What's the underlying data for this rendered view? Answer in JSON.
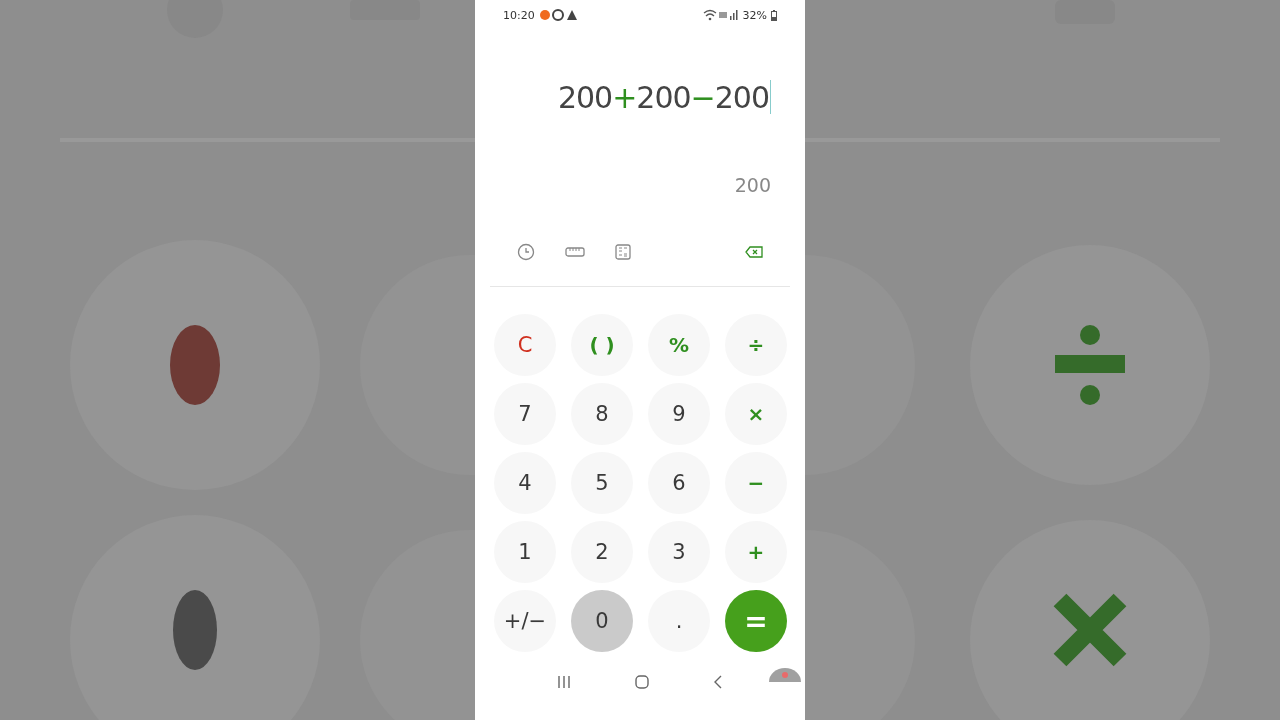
{
  "status_bar": {
    "time": "10:20",
    "battery": "32%"
  },
  "display": {
    "expression": [
      {
        "text": "200",
        "kind": "number"
      },
      {
        "text": "+",
        "kind": "operator"
      },
      {
        "text": "200",
        "kind": "number"
      },
      {
        "text": "−",
        "kind": "operator"
      },
      {
        "text": "200",
        "kind": "number"
      }
    ],
    "result": "200"
  },
  "keys": [
    {
      "label": "C",
      "kind": "clear",
      "pressed": false
    },
    {
      "label": "( )",
      "kind": "operator",
      "pressed": false
    },
    {
      "label": "%",
      "kind": "operator",
      "pressed": false
    },
    {
      "label": "÷",
      "kind": "operator",
      "pressed": false
    },
    {
      "label": "7",
      "kind": "digit",
      "pressed": false
    },
    {
      "label": "8",
      "kind": "digit",
      "pressed": false
    },
    {
      "label": "9",
      "kind": "digit",
      "pressed": false
    },
    {
      "label": "×",
      "kind": "operator",
      "pressed": false
    },
    {
      "label": "4",
      "kind": "digit",
      "pressed": false
    },
    {
      "label": "5",
      "kind": "digit",
      "pressed": false
    },
    {
      "label": "6",
      "kind": "digit",
      "pressed": false
    },
    {
      "label": "−",
      "kind": "operator",
      "pressed": false
    },
    {
      "label": "1",
      "kind": "digit",
      "pressed": false
    },
    {
      "label": "2",
      "kind": "digit",
      "pressed": false
    },
    {
      "label": "3",
      "kind": "digit",
      "pressed": false
    },
    {
      "label": "+",
      "kind": "operator",
      "pressed": false
    },
    {
      "label": "+/−",
      "kind": "digit",
      "pressed": false
    },
    {
      "label": "0",
      "kind": "digit",
      "pressed": true
    },
    {
      "label": ".",
      "kind": "digit",
      "pressed": false
    },
    {
      "label": "=",
      "kind": "equals",
      "pressed": false
    }
  ]
}
